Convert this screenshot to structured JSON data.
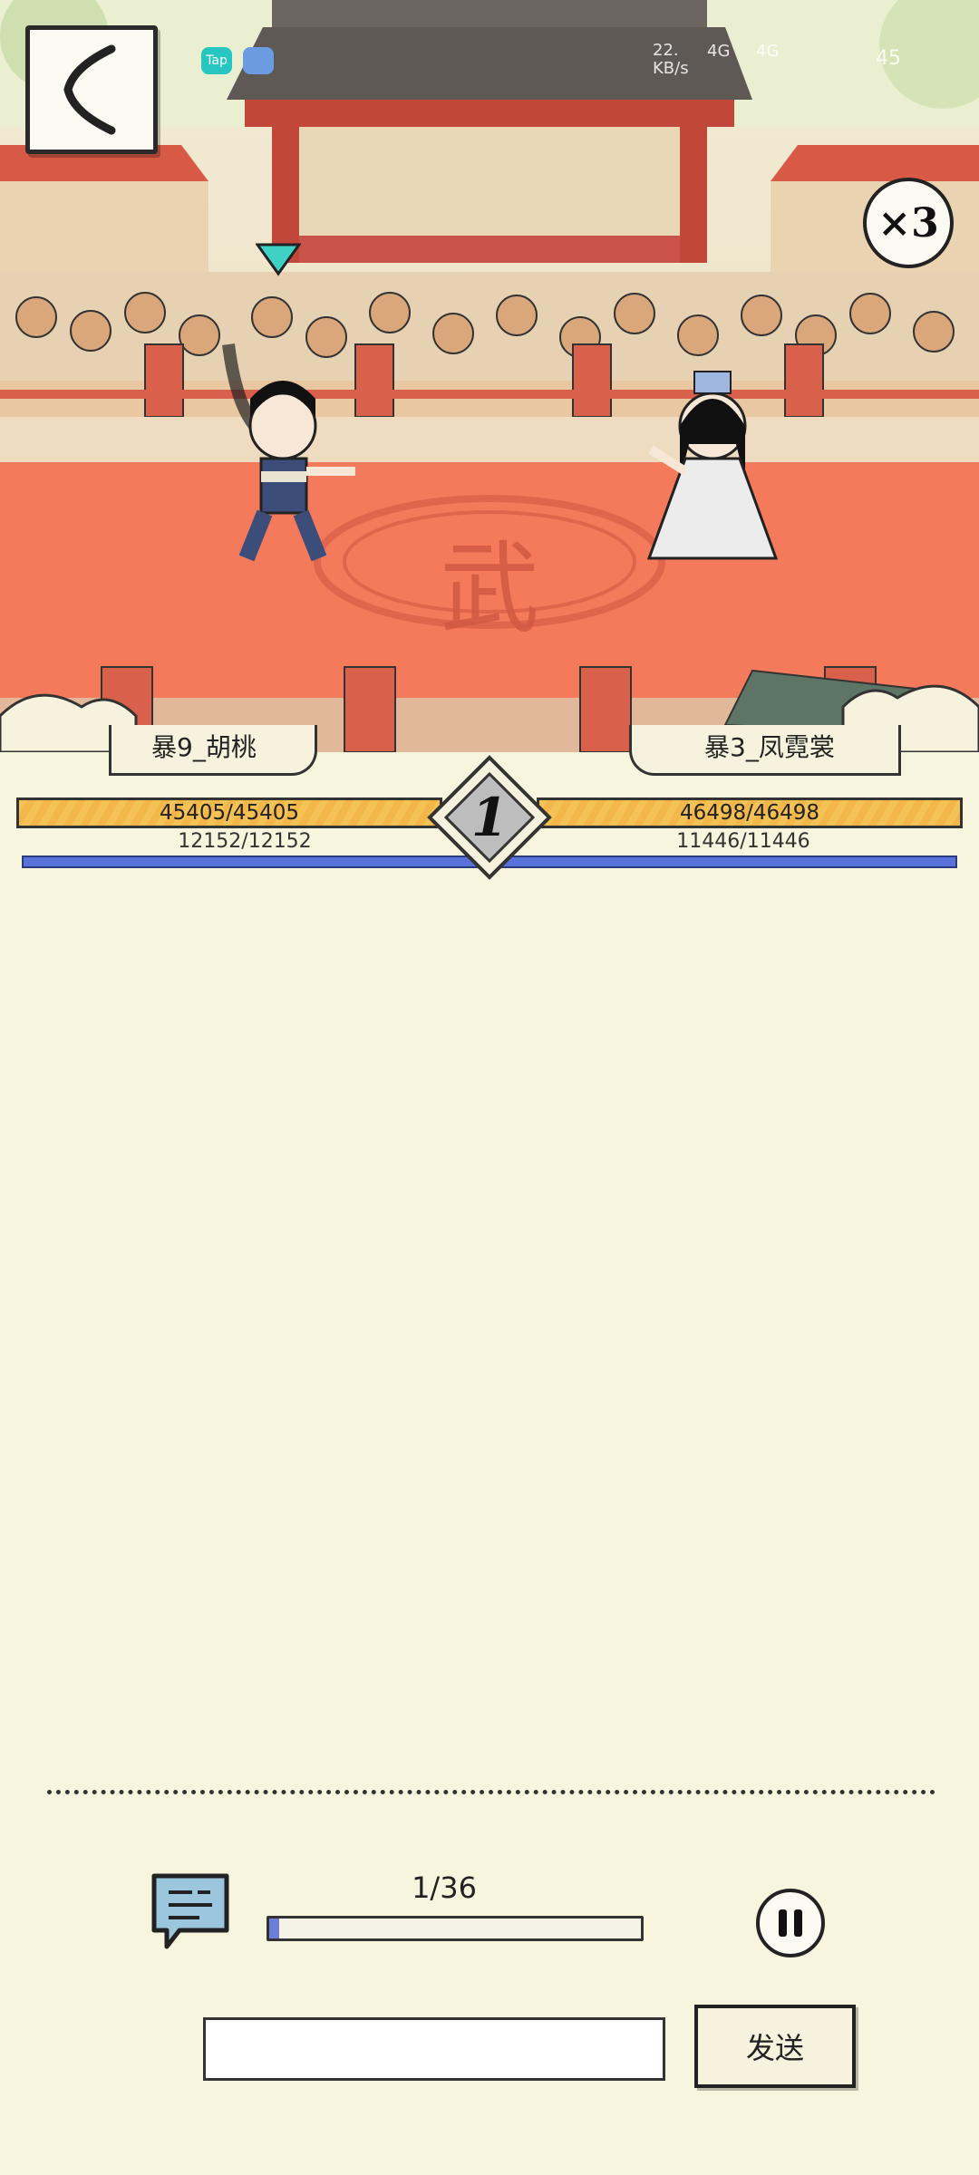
{
  "status_bar": {
    "time": "",
    "app_badges": [
      "Tap",
      ""
    ],
    "net_speed_top": "22.",
    "net_speed_bottom": "KB/s",
    "net_1": "4G",
    "net_2": "4G",
    "battery": "45"
  },
  "controls": {
    "speed_label": "×3"
  },
  "battle": {
    "round_number": "1",
    "left_fighter": {
      "name": "暴9_胡桃",
      "hp_text": "45405/45405",
      "mp_text": "12152/12152",
      "hp_fraction": 1.0,
      "mp_fraction": 1.0
    },
    "right_fighter": {
      "name": "暴3_凤霓裳",
      "hp_text": "46498/46498",
      "mp_text": "11446/11446",
      "hp_fraction": 1.0,
      "mp_fraction": 1.0
    },
    "arena_emblem": "武"
  },
  "playback": {
    "progress_label": "1/36",
    "progress_fraction": 0.0278
  },
  "chat": {
    "input_value": "",
    "input_placeholder": "",
    "send_label": "发送"
  },
  "colors": {
    "hp": "#f5c256",
    "mp": "#5972d9",
    "arena_floor": "#f57a5c",
    "panel_bg": "#f8f5df"
  }
}
